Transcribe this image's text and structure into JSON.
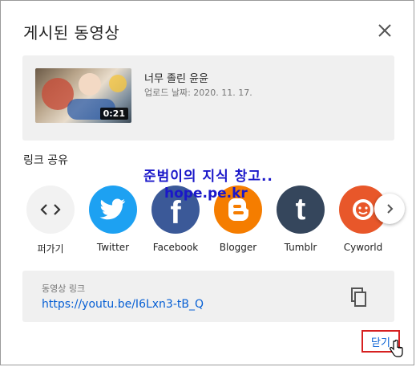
{
  "dialog": {
    "title": "게시된 동영상"
  },
  "video": {
    "title": "너무 졸린 윤윤",
    "upload_date": "업로드 날짜: 2020. 11. 17.",
    "duration": "0:21"
  },
  "share": {
    "label": "링크 공유",
    "items": [
      {
        "name": "퍼가기",
        "icon": "embed-icon",
        "color": "#f2f2f2"
      },
      {
        "name": "Twitter",
        "icon": "twitter-icon",
        "color": "#1da1f2"
      },
      {
        "name": "Facebook",
        "icon": "facebook-icon",
        "color": "#3b5998"
      },
      {
        "name": "Blogger",
        "icon": "blogger-icon",
        "color": "#f57d00"
      },
      {
        "name": "Tumblr",
        "icon": "tumblr-icon",
        "color": "#35465c"
      },
      {
        "name": "Cyworld",
        "icon": "cyworld-icon",
        "color": "#e8572a"
      }
    ]
  },
  "watermark": {
    "line1": "준범이의 지식 창고..",
    "line2": "hope.pe.kr"
  },
  "link": {
    "label": "동영상 링크",
    "url": "https://youtu.be/I6Lxn3-tB_Q"
  },
  "footer": {
    "close_label": "닫기"
  }
}
